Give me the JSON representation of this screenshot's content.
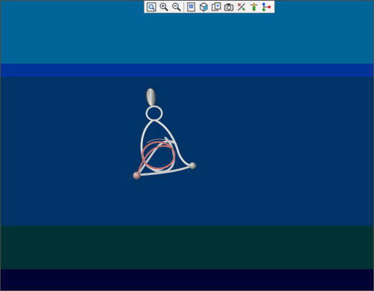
{
  "viewer": {
    "background_colors": {
      "sky": "#006699",
      "stripe": "#003399",
      "main": "#003366",
      "floor": "#003333",
      "bottom": "#000033"
    }
  },
  "toolbar": {
    "tools": [
      {
        "name": "zoom-fit-icon"
      },
      {
        "name": "zoom-in-icon"
      },
      {
        "name": "zoom-out-icon"
      },
      {
        "name": "page-view-icon"
      },
      {
        "name": "cube-view-icon"
      },
      {
        "name": "copy-image-icon"
      },
      {
        "name": "camera-icon"
      },
      {
        "name": "rotate-axes-icon"
      },
      {
        "name": "lighting-icon"
      },
      {
        "name": "connect-nodes-icon"
      }
    ]
  },
  "model": {
    "name": "triquetra-pendant",
    "colors": {
      "silver": "#c8c8c8",
      "copper": "#c47070",
      "bail": "#9a9a9a"
    }
  }
}
